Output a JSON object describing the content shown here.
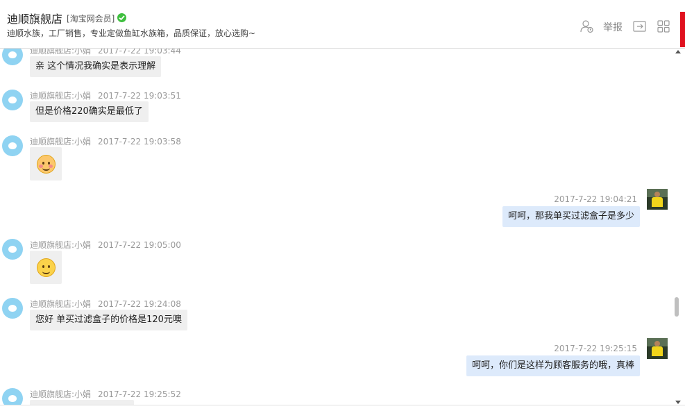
{
  "header": {
    "shop_name": "迪顺旗舰店",
    "member_tag": "[淘宝网会员]",
    "description": "迪顺水族，工厂销售，专业定做鱼缸水族箱，品质保证，放心选购~",
    "report_label": "举报",
    "icons": [
      "person-clock-icon",
      "exit-icon",
      "grid-icon",
      "verified-check-icon"
    ]
  },
  "messages": [
    {
      "side": "left",
      "sender": "迪顺旗舰店:小娟",
      "time": "2017-7-22 19:03:44",
      "type": "text",
      "text": "亲 这个情况我确实是表示理解"
    },
    {
      "side": "left",
      "sender": "迪顺旗舰店:小娟",
      "time": "2017-7-22 19:03:51",
      "type": "text",
      "text": "但是价格220确实是最低了"
    },
    {
      "side": "left",
      "sender": "迪顺旗舰店:小娟",
      "time": "2017-7-22 19:03:58",
      "type": "emoji",
      "emoji": "shy-face-emoji"
    },
    {
      "side": "right",
      "time": "2017-7-22 19:04:21",
      "type": "text",
      "text": "呵呵，那我单买过滤盒子是多少"
    },
    {
      "side": "left",
      "sender": "迪顺旗舰店:小娟",
      "time": "2017-7-22 19:05:00",
      "type": "emoji",
      "emoji": "smile-face-emoji"
    },
    {
      "side": "left",
      "sender": "迪顺旗舰店:小娟",
      "time": "2017-7-22 19:24:08",
      "type": "text",
      "text": "您好 单买过滤盒子的价格是120元噢"
    },
    {
      "side": "right",
      "time": "2017-7-22 19:25:15",
      "type": "text",
      "text": "呵呵，你们是这样为顾客服务的哦，真棒"
    },
    {
      "side": "left",
      "sender": "迪顺旗舰店:小娟",
      "time": "2017-7-22 19:25:52",
      "type": "text",
      "text": ""
    }
  ],
  "colors": {
    "accent_red": "#e0101e",
    "seller_bubble": "#efefef",
    "buyer_bubble": "#ddeafb",
    "seller_avatar": "#8fd3f2"
  }
}
